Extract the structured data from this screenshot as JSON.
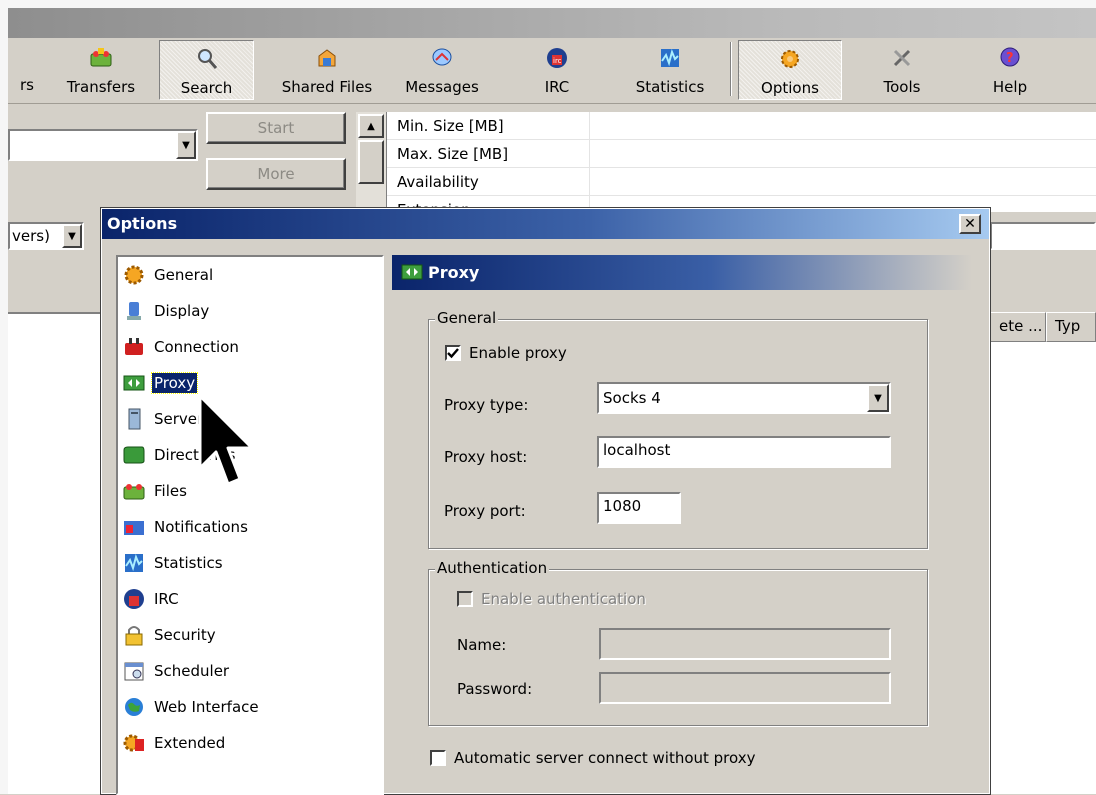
{
  "toolbar": {
    "partial_left": "rs",
    "buttons": [
      {
        "label": "Transfers",
        "icon": "transfers-icon"
      },
      {
        "label": "Search",
        "icon": "search-icon"
      },
      {
        "label": "Shared Files",
        "icon": "shared-files-icon"
      },
      {
        "label": "Messages",
        "icon": "messages-icon"
      },
      {
        "label": "IRC",
        "icon": "irc-icon"
      },
      {
        "label": "Statistics",
        "icon": "statistics-icon"
      },
      {
        "label": "Options",
        "icon": "options-icon"
      },
      {
        "label": "Tools",
        "icon": "tools-icon"
      },
      {
        "label": "Help",
        "icon": "help-icon"
      }
    ]
  },
  "search_panel": {
    "start_label": "Start",
    "more_label": "More",
    "server_combo_text": "vers)",
    "params": [
      "Min. Size [MB]",
      "Max. Size [MB]",
      "Availability",
      "Extension"
    ],
    "results_columns": [
      "ete ...",
      "Typ"
    ]
  },
  "dialog": {
    "title": "Options",
    "close_label": "x",
    "categories": [
      {
        "label": "General",
        "icon": "general-icon"
      },
      {
        "label": "Display",
        "icon": "display-icon"
      },
      {
        "label": "Connection",
        "icon": "connection-icon"
      },
      {
        "label": "Proxy",
        "icon": "proxy-icon",
        "selected": true
      },
      {
        "label": "Server",
        "icon": "server-icon"
      },
      {
        "label": "Directories",
        "icon": "directories-icon"
      },
      {
        "label": "Files",
        "icon": "files-icon"
      },
      {
        "label": "Notifications",
        "icon": "notifications-icon"
      },
      {
        "label": "Statistics",
        "icon": "statistics-icon"
      },
      {
        "label": "IRC",
        "icon": "irc-icon"
      },
      {
        "label": "Security",
        "icon": "security-icon"
      },
      {
        "label": "Scheduler",
        "icon": "scheduler-icon"
      },
      {
        "label": "Web Interface",
        "icon": "web-interface-icon"
      },
      {
        "label": "Extended",
        "icon": "extended-icon"
      }
    ],
    "page_title": "Proxy",
    "general_group": {
      "legend": "General",
      "enable_proxy_label": "Enable proxy",
      "enable_proxy_checked": true,
      "proxy_type_label": "Proxy type:",
      "proxy_type_value": "Socks 4",
      "proxy_host_label": "Proxy host:",
      "proxy_host_value": "localhost",
      "proxy_port_label": "Proxy port:",
      "proxy_port_value": "1080"
    },
    "auth_group": {
      "legend": "Authentication",
      "enable_auth_label": "Enable authentication",
      "enable_auth_checked": false,
      "name_label": "Name:",
      "name_value": "",
      "password_label": "Password:",
      "password_value": ""
    },
    "auto_connect_label": "Automatic server connect without proxy",
    "auto_connect_checked": false
  },
  "colors": {
    "title_gradient_start": "#0a246a",
    "title_gradient_end": "#a6caf0",
    "selection": "#0a246a",
    "window_bg": "#d4d0c8"
  }
}
